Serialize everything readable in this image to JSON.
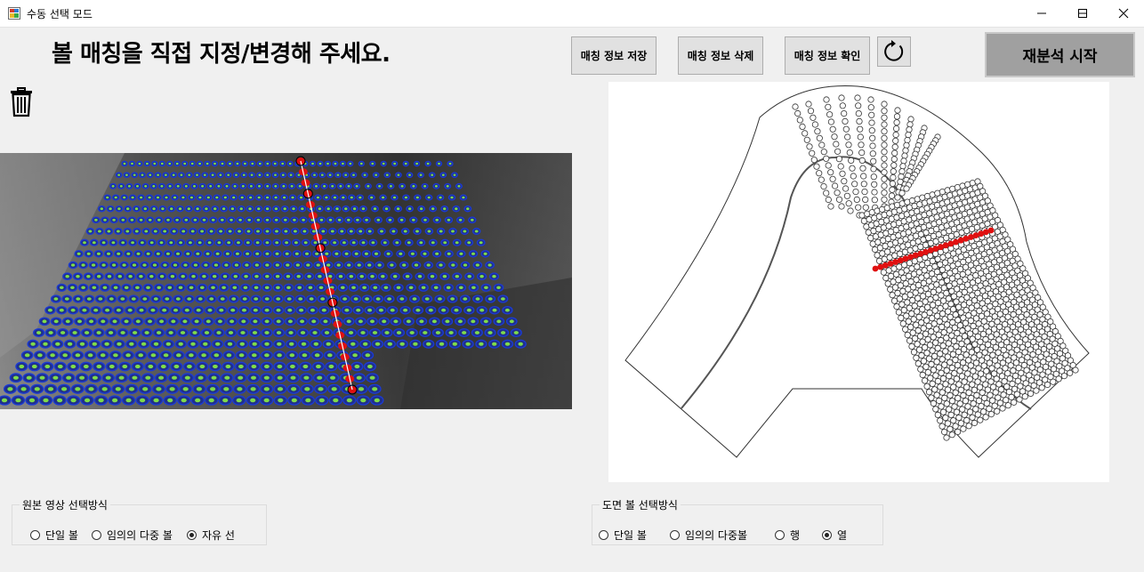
{
  "window": {
    "title": "수동 선택 모드",
    "minimize_glyph": "—",
    "close_glyph": "✕"
  },
  "heading": "볼 매칭을 직접 지정/변경해 주세요.",
  "toolbar": {
    "save_label": "매칭 정보 저장",
    "delete_label": "매칭 정보 삭제",
    "check_label": "매칭 정보 확인",
    "reanalyze_label": "재분석 시작"
  },
  "icons": {
    "trash": "trash-icon",
    "refresh": "refresh-icon",
    "app": "app-icon"
  },
  "source_group": {
    "legend": "원본 영상 선택방식",
    "options": [
      "단일 볼",
      "임의의 다중 볼",
      "자유 선"
    ],
    "selected_index": 2
  },
  "drawing_group": {
    "legend": "도면 볼 선택방식",
    "options": [
      "단일 볼",
      "임의의 다중볼",
      "행",
      "열"
    ],
    "selected_index": 3
  },
  "colors": {
    "detected_ball": "#1a3ad6",
    "selected_ball": "#e01010",
    "ball_center": "#7fdc4a",
    "photo_bg": "#6e6e6e"
  }
}
